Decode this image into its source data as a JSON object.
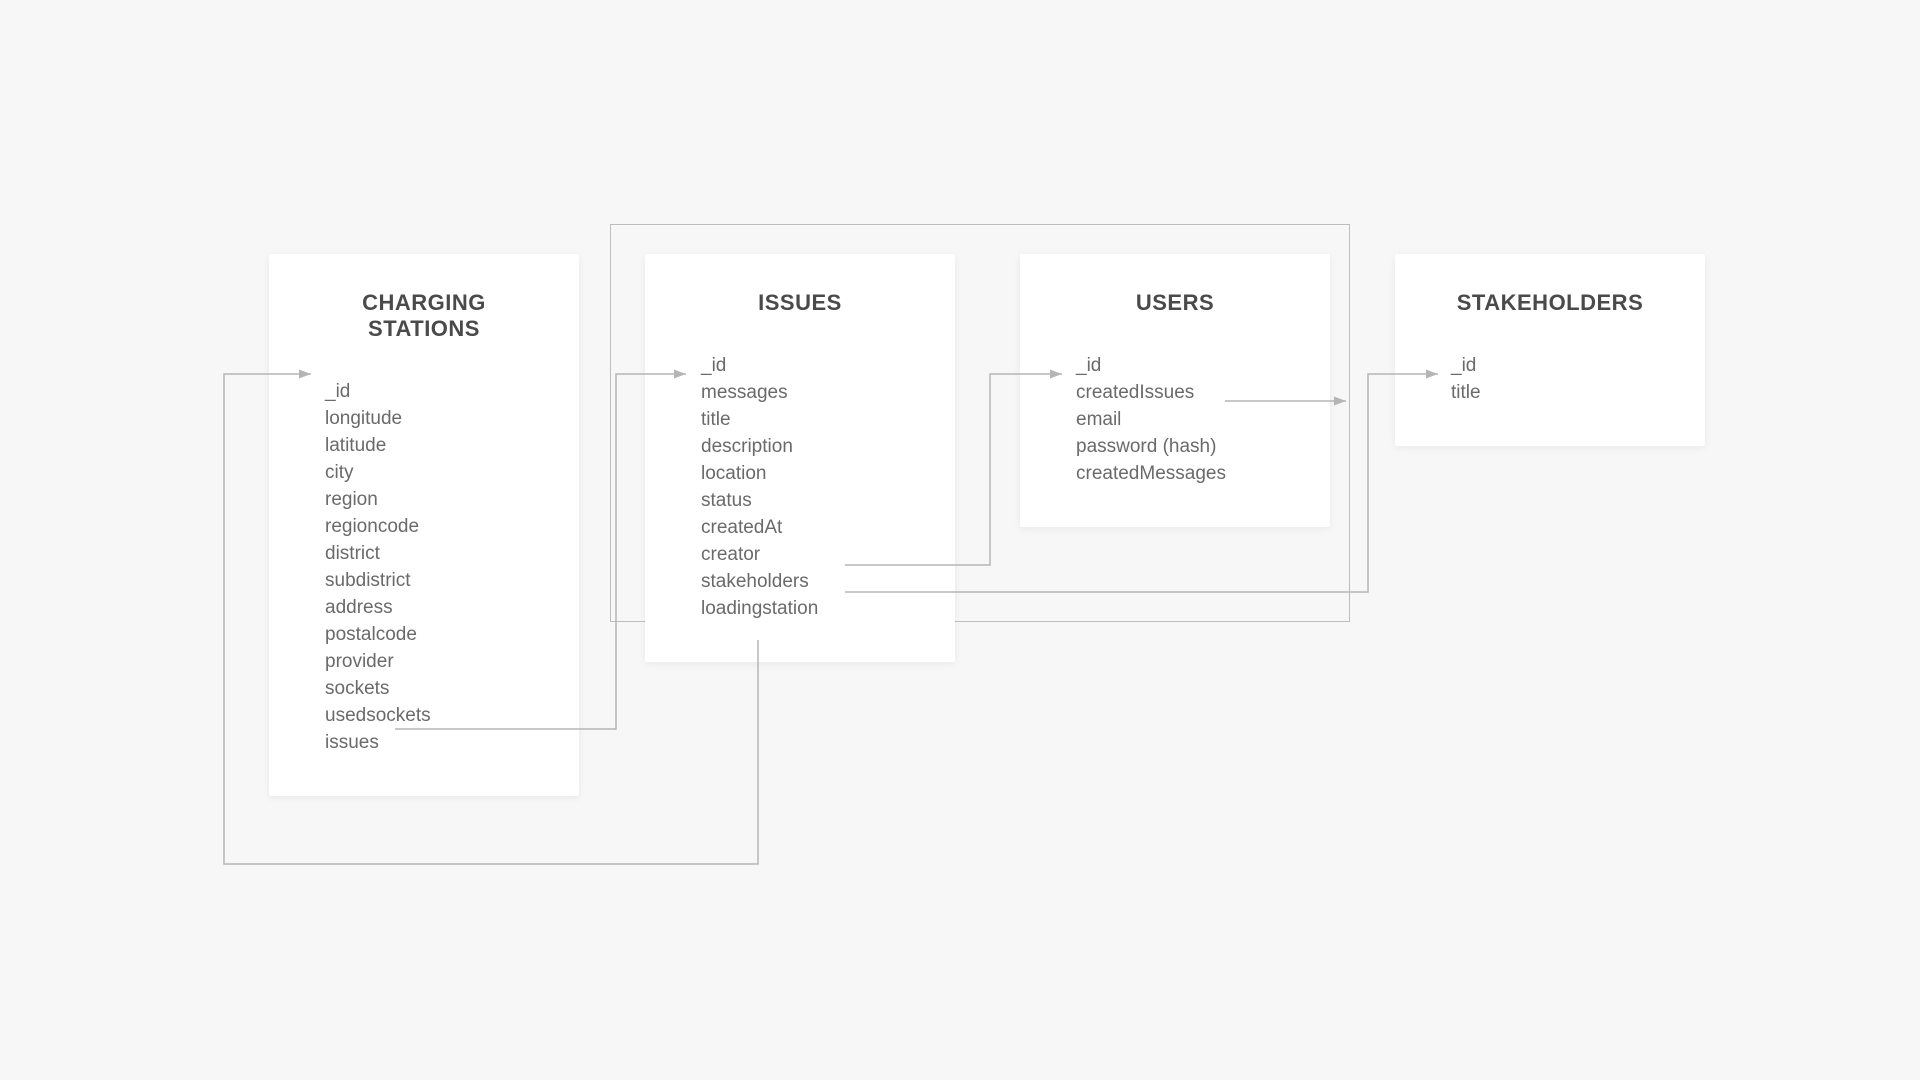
{
  "entities": {
    "charging": {
      "title": "CHARGING STATIONS",
      "fields": [
        "_id",
        "longitude",
        "latitude",
        "city",
        "region",
        "regioncode",
        "district",
        "subdistrict",
        "address",
        "postalcode",
        "provider",
        "sockets",
        "usedsockets",
        "issues"
      ]
    },
    "issues": {
      "title": "ISSUES",
      "fields": [
        "_id",
        "messages",
        "title",
        "description",
        "location",
        "status",
        "createdAt",
        "creator",
        "stakeholders",
        "loadingstation"
      ]
    },
    "users": {
      "title": "USERS",
      "fields": [
        "_id",
        "createdIssues",
        "email",
        "password (hash)",
        "createdMessages"
      ]
    },
    "stakeholders": {
      "title": "STAKEHOLDERS",
      "fields": [
        "_id",
        "title"
      ]
    }
  },
  "relationships": [
    {
      "from": "charging.issues",
      "to": "issues._id"
    },
    {
      "from": "issues.creator",
      "to": "users._id"
    },
    {
      "from": "issues.stakeholders",
      "to": "stakeholders._id"
    },
    {
      "from": "issues.loadingstation",
      "to": "charging._id"
    },
    {
      "from": "users.createdIssues",
      "to": "(group)"
    }
  ],
  "colors": {
    "bg": "#f7f7f7",
    "card": "#ffffff",
    "text": "#6a6a6a",
    "line": "#b5b5b5"
  }
}
